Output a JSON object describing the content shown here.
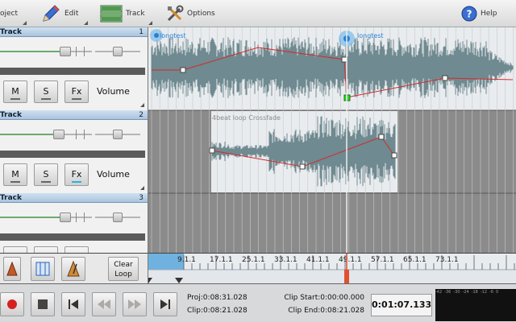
{
  "toolbar": {
    "items": [
      {
        "label": "oject",
        "icon": "project-icon"
      },
      {
        "label": "Edit",
        "icon": "pencil-icon"
      },
      {
        "label": "Track",
        "icon": "track-grid-icon"
      },
      {
        "label": "Options",
        "icon": "tools-icon"
      },
      {
        "label": "Help",
        "icon": "help-icon"
      }
    ]
  },
  "tracks": [
    {
      "name": "Track",
      "number": "1",
      "mute": "M",
      "solo": "S",
      "fx": "Fx",
      "param": "Volume",
      "volume_level": 0.44
    },
    {
      "name": "Track",
      "number": "2",
      "mute": "M",
      "solo": "S",
      "fx": "Fx",
      "param": "Volume",
      "volume_level": 0.4
    },
    {
      "name": "Track",
      "number": "3",
      "volume_level": 0.44
    }
  ],
  "clips": [
    {
      "label": "longtest"
    },
    {
      "label": "longtest"
    },
    {
      "label": "4beat loop Crossfade"
    }
  ],
  "ruler": {
    "marks": [
      "9.1.1",
      "17.1.1",
      "25.1.1",
      "33.1.1",
      "41.1.1",
      "49.1.1",
      "57.1.1",
      "65.1.1",
      "73.1.1"
    ]
  },
  "tools": {
    "clear_loop": "Clear\nLoop"
  },
  "transport": {
    "proj": "Proj:0:08:31.028",
    "clip": "Clip:0:08:21.028",
    "clip_start": "Clip Start:0:00:00.000",
    "clip_end": "Clip End:0:08:21.028",
    "time": "0:01:07.133",
    "meter_scale": [
      "-42",
      "-36",
      "-30",
      "-24",
      "-18",
      "-12",
      "-6",
      "0"
    ]
  },
  "colors": {
    "accent": "#2a7fd4",
    "playhead": "#e05030",
    "wave": "#6f8a90",
    "envelope": "#d42a2a"
  }
}
